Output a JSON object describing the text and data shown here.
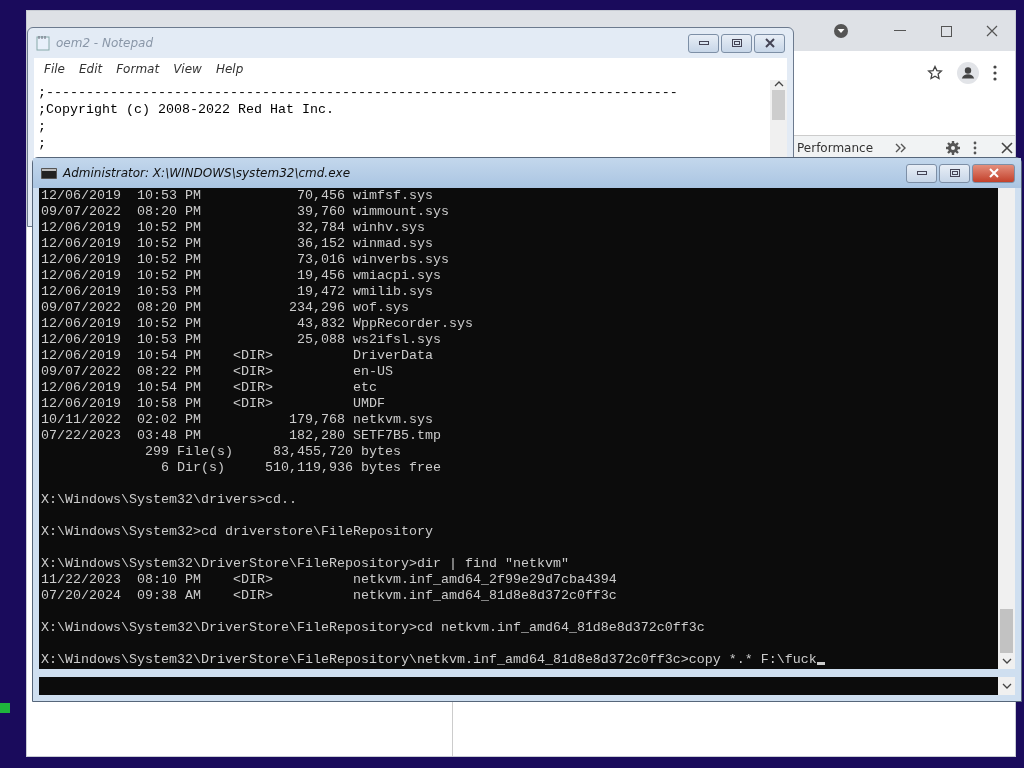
{
  "browser": {
    "devtools": {
      "tab": "Performance"
    }
  },
  "notepad": {
    "title": "oem2 - Notepad",
    "active": false,
    "menu": [
      "File",
      "Edit",
      "Format",
      "View",
      "Help"
    ],
    "lines": [
      ";-------------------------------------------------------------------------------",
      ";Copyright (c) 2008-2022 Red Hat Inc.",
      ";",
      ";"
    ]
  },
  "cmd": {
    "title": "Administrator: X:\\WINDOWS\\system32\\cmd.exe",
    "active": true,
    "blocks": [
      [
        "12/06/2019  10:53 PM            70,456 wimfsf.sys",
        "09/07/2022  08:20 PM            39,760 wimmount.sys",
        "12/06/2019  10:52 PM            32,784 winhv.sys",
        "12/06/2019  10:52 PM            36,152 winmad.sys",
        "12/06/2019  10:52 PM            73,016 winverbs.sys",
        "12/06/2019  10:52 PM            19,456 wmiacpi.sys",
        "12/06/2019  10:53 PM            19,472 wmilib.sys",
        "09/07/2022  08:20 PM           234,296 wof.sys",
        "12/06/2019  10:52 PM            43,832 WppRecorder.sys",
        "12/06/2019  10:53 PM            25,088 ws2ifsl.sys",
        "12/06/2019  10:54 PM    <DIR>          DriverData",
        "09/07/2022  08:22 PM    <DIR>          en-US",
        "12/06/2019  10:54 PM    <DIR>          etc",
        "12/06/2019  10:58 PM    <DIR>          UMDF",
        "10/11/2022  02:02 PM           179,768 netkvm.sys",
        "07/22/2023  03:48 PM           182,280 SETF7B5.tmp",
        "             299 File(s)     83,455,720 bytes",
        "               6 Dir(s)     510,119,936 bytes free"
      ],
      [
        "X:\\Windows\\System32\\drivers>cd.."
      ],
      [
        "X:\\Windows\\System32>cd driverstore\\FileRepository"
      ],
      [
        "X:\\Windows\\System32\\DriverStore\\FileRepository>dir | find \"netkvm\"",
        "11/22/2023  08:10 PM    <DIR>          netkvm.inf_amd64_2f99e29d7cba4394",
        "07/20/2024  09:38 AM    <DIR>          netkvm.inf_amd64_81d8e8d372c0ff3c"
      ],
      [
        "X:\\Windows\\System32\\DriverStore\\FileRepository>cd netkvm.inf_amd64_81d8e8d372c0ff3c"
      ],
      [
        "X:\\Windows\\System32\\DriverStore\\FileRepository\\netkvm.inf_amd64_81d8e8d372c0ff3c>copy *.* F:\\fuck"
      ]
    ]
  }
}
